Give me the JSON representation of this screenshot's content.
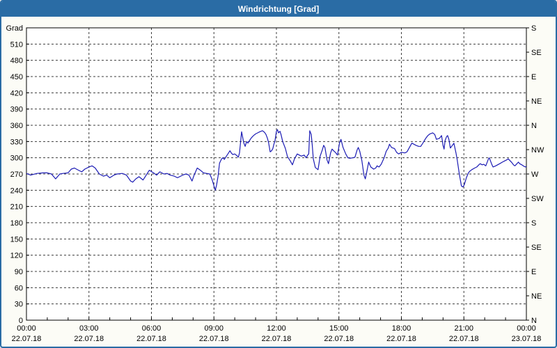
{
  "window": {
    "title": "Windrichtung [Grad]"
  },
  "colors": {
    "accent": "#2a6ca5",
    "line": "#1b1bb4",
    "grid": "#3c3c3c",
    "axis": "#000000",
    "plot_background": "#ffffff",
    "window_background": "#fcfcf6",
    "title_text": "#ffffff"
  },
  "chart_data": {
    "type": "line",
    "title": "Windrichtung [Grad]",
    "ylabel": "Grad",
    "ylim": [
      0,
      540
    ],
    "y_left_tick_step": 30,
    "y_left_ticks": [
      0,
      30,
      60,
      90,
      120,
      150,
      180,
      210,
      240,
      270,
      300,
      330,
      360,
      390,
      420,
      450,
      480,
      510
    ],
    "y_left_title": "Grad",
    "y_right_labels_top_to_bottom": [
      "S",
      "SE",
      "E",
      "NE",
      "N",
      "NW",
      "W",
      "SW",
      "S",
      "SE",
      "E",
      "NE",
      "N"
    ],
    "y_right_tick_step": 45,
    "xlim_hours": [
      0,
      24
    ],
    "x_minor_tick_hours": 1,
    "x_major_tick_hours": 3,
    "x_ticks": [
      {
        "time": "00:00",
        "date": "22.07.18"
      },
      {
        "time": "03:00",
        "date": "22.07.18"
      },
      {
        "time": "06:00",
        "date": "22.07.18"
      },
      {
        "time": "09:00",
        "date": "22.07.18"
      },
      {
        "time": "12:00",
        "date": "22.07.18"
      },
      {
        "time": "15:00",
        "date": "22.07.18"
      },
      {
        "time": "18:00",
        "date": "22.07.18"
      },
      {
        "time": "21:00",
        "date": "22.07.18"
      },
      {
        "time": "00:00",
        "date": "23.07.18"
      }
    ],
    "grid": "dashed",
    "legend": "none",
    "points": [
      [
        0,
        271
      ],
      [
        0.2,
        268
      ],
      [
        0.5,
        271
      ],
      [
        0.8,
        272
      ],
      [
        1,
        272
      ],
      [
        1.2,
        270
      ],
      [
        1.4,
        261
      ],
      [
        1.6,
        270
      ],
      [
        1.75,
        271
      ],
      [
        2,
        272
      ],
      [
        2.15,
        279
      ],
      [
        2.3,
        281
      ],
      [
        2.5,
        277
      ],
      [
        2.65,
        274
      ],
      [
        2.8,
        279
      ],
      [
        3,
        283
      ],
      [
        3.15,
        285
      ],
      [
        3.3,
        281
      ],
      [
        3.5,
        270
      ],
      [
        3.7,
        266
      ],
      [
        3.85,
        268
      ],
      [
        4,
        263
      ],
      [
        4.2,
        268
      ],
      [
        4.35,
        270
      ],
      [
        4.6,
        271
      ],
      [
        4.8,
        268
      ],
      [
        5,
        257
      ],
      [
        5.1,
        255
      ],
      [
        5.25,
        261
      ],
      [
        5.4,
        265
      ],
      [
        5.6,
        259
      ],
      [
        5.75,
        268
      ],
      [
        5.9,
        277
      ],
      [
        6.1,
        272
      ],
      [
        6.25,
        268
      ],
      [
        6.4,
        274
      ],
      [
        6.6,
        270
      ],
      [
        6.75,
        271
      ],
      [
        6.9,
        268
      ],
      [
        7.1,
        266
      ],
      [
        7.25,
        263
      ],
      [
        7.5,
        268
      ],
      [
        7.65,
        270
      ],
      [
        7.8,
        268
      ],
      [
        7.95,
        257
      ],
      [
        8.05,
        268
      ],
      [
        8.2,
        281
      ],
      [
        8.35,
        277
      ],
      [
        8.5,
        272
      ],
      [
        8.65,
        271
      ],
      [
        8.8,
        270
      ],
      [
        8.9,
        261
      ],
      [
        9,
        248
      ],
      [
        9.07,
        240
      ],
      [
        9.13,
        250
      ],
      [
        9.2,
        266
      ],
      [
        9.27,
        290
      ],
      [
        9.37,
        298
      ],
      [
        9.43,
        300
      ],
      [
        9.5,
        297
      ],
      [
        9.6,
        303
      ],
      [
        9.67,
        307
      ],
      [
        9.77,
        313
      ],
      [
        9.83,
        309
      ],
      [
        9.9,
        306
      ],
      [
        10,
        307
      ],
      [
        10.1,
        304
      ],
      [
        10.17,
        301
      ],
      [
        10.23,
        309
      ],
      [
        10.33,
        348
      ],
      [
        10.43,
        328
      ],
      [
        10.5,
        321
      ],
      [
        10.57,
        330
      ],
      [
        10.63,
        327
      ],
      [
        10.73,
        333
      ],
      [
        10.8,
        337
      ],
      [
        10.9,
        341
      ],
      [
        11,
        344
      ],
      [
        11.1,
        346
      ],
      [
        11.2,
        348
      ],
      [
        11.33,
        350
      ],
      [
        11.43,
        347
      ],
      [
        11.5,
        343
      ],
      [
        11.57,
        336
      ],
      [
        11.63,
        327
      ],
      [
        11.7,
        311
      ],
      [
        11.77,
        313
      ],
      [
        11.83,
        317
      ],
      [
        11.88,
        325
      ],
      [
        11.93,
        331
      ],
      [
        12,
        349
      ],
      [
        12.05,
        352
      ],
      [
        12.1,
        346
      ],
      [
        12.17,
        349
      ],
      [
        12.22,
        343
      ],
      [
        12.3,
        330
      ],
      [
        12.43,
        317
      ],
      [
        12.53,
        302
      ],
      [
        12.67,
        294
      ],
      [
        12.77,
        287
      ],
      [
        12.87,
        298
      ],
      [
        13,
        307
      ],
      [
        13.1,
        305
      ],
      [
        13.2,
        303
      ],
      [
        13.33,
        305
      ],
      [
        13.43,
        300
      ],
      [
        13.5,
        305
      ],
      [
        13.55,
        307
      ],
      [
        13.6,
        350
      ],
      [
        13.67,
        343
      ],
      [
        13.72,
        323
      ],
      [
        13.77,
        298
      ],
      [
        13.87,
        282
      ],
      [
        14,
        278
      ],
      [
        14.1,
        303
      ],
      [
        14.2,
        314
      ],
      [
        14.27,
        323
      ],
      [
        14.33,
        319
      ],
      [
        14.43,
        296
      ],
      [
        14.5,
        289
      ],
      [
        14.6,
        309
      ],
      [
        14.67,
        316
      ],
      [
        14.77,
        312
      ],
      [
        14.83,
        310
      ],
      [
        14.93,
        305
      ],
      [
        15.03,
        327
      ],
      [
        15.1,
        334
      ],
      [
        15.2,
        319
      ],
      [
        15.33,
        307
      ],
      [
        15.43,
        300
      ],
      [
        15.53,
        299
      ],
      [
        15.67,
        300
      ],
      [
        15.77,
        301
      ],
      [
        15.87,
        314
      ],
      [
        15.93,
        319
      ],
      [
        16,
        312
      ],
      [
        16.1,
        295
      ],
      [
        16.2,
        268
      ],
      [
        16.27,
        261
      ],
      [
        16.33,
        272
      ],
      [
        16.43,
        292
      ],
      [
        16.53,
        283
      ],
      [
        16.67,
        279
      ],
      [
        16.77,
        281
      ],
      [
        16.83,
        285
      ],
      [
        16.93,
        283
      ],
      [
        17.03,
        288
      ],
      [
        17.17,
        300
      ],
      [
        17.27,
        312
      ],
      [
        17.37,
        318
      ],
      [
        17.43,
        325
      ],
      [
        17.53,
        319
      ],
      [
        17.67,
        317
      ],
      [
        17.77,
        310
      ],
      [
        17.87,
        307
      ],
      [
        18,
        310
      ],
      [
        18.17,
        309
      ],
      [
        18.27,
        311
      ],
      [
        18.37,
        318
      ],
      [
        18.5,
        327
      ],
      [
        18.6,
        325
      ],
      [
        18.7,
        323
      ],
      [
        18.83,
        321
      ],
      [
        18.93,
        321
      ],
      [
        19.03,
        327
      ],
      [
        19.17,
        336
      ],
      [
        19.27,
        341
      ],
      [
        19.37,
        344
      ],
      [
        19.5,
        346
      ],
      [
        19.6,
        343
      ],
      [
        19.68,
        334
      ],
      [
        19.83,
        336
      ],
      [
        19.93,
        341
      ],
      [
        20,
        323
      ],
      [
        20.05,
        316
      ],
      [
        20.1,
        332
      ],
      [
        20.17,
        339
      ],
      [
        20.22,
        341
      ],
      [
        20.28,
        334
      ],
      [
        20.35,
        318
      ],
      [
        20.45,
        323
      ],
      [
        20.52,
        327
      ],
      [
        20.62,
        309
      ],
      [
        20.68,
        296
      ],
      [
        20.78,
        270
      ],
      [
        20.88,
        248
      ],
      [
        20.95,
        246
      ],
      [
        21.02,
        250
      ],
      [
        21.12,
        263
      ],
      [
        21.22,
        272
      ],
      [
        21.28,
        275
      ],
      [
        21.38,
        278
      ],
      [
        21.52,
        281
      ],
      [
        21.62,
        283
      ],
      [
        21.72,
        287
      ],
      [
        21.78,
        289
      ],
      [
        21.88,
        287
      ],
      [
        21.95,
        288
      ],
      [
        22.05,
        285
      ],
      [
        22.18,
        298
      ],
      [
        22.22,
        300
      ],
      [
        22.28,
        294
      ],
      [
        22.35,
        287
      ],
      [
        22.4,
        283
      ],
      [
        22.53,
        285
      ],
      [
        22.62,
        287
      ],
      [
        22.72,
        289
      ],
      [
        22.85,
        292
      ],
      [
        22.95,
        294
      ],
      [
        23.05,
        296
      ],
      [
        23.13,
        298
      ],
      [
        23.18,
        296
      ],
      [
        23.28,
        292
      ],
      [
        23.38,
        287
      ],
      [
        23.45,
        285
      ],
      [
        23.55,
        289
      ],
      [
        23.62,
        292
      ],
      [
        23.68,
        289
      ],
      [
        23.78,
        287
      ],
      [
        23.85,
        285
      ],
      [
        23.95,
        283
      ],
      [
        24,
        284
      ]
    ]
  }
}
